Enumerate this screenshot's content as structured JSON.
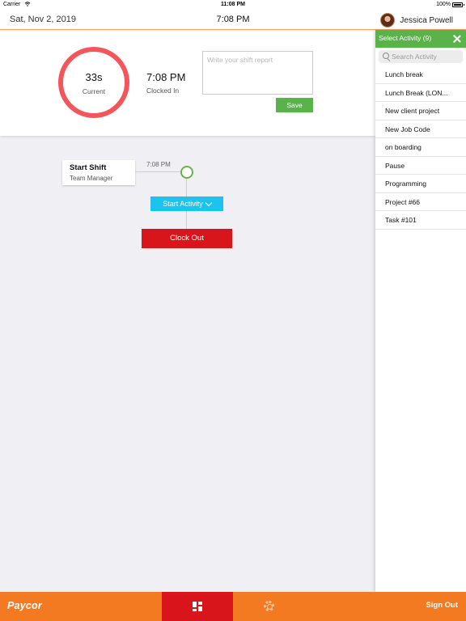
{
  "status_bar": {
    "carrier": "Carrier",
    "clock": "11:08 PM",
    "battery_percent": "100%",
    "icons": [
      "wifi-icon",
      "battery-icon"
    ]
  },
  "top_nav": {
    "date": "Sat, Nov 2, 2019",
    "time": "7:08 PM",
    "user_name": "Jessica Powell"
  },
  "header": {
    "elapsed_value": "33s",
    "elapsed_label": "Current",
    "clocked_time": "7:08 PM",
    "clocked_label": "Clocked In",
    "report_placeholder": "Write your shift report",
    "report_value": "",
    "save_label": "Save"
  },
  "timeline": {
    "shift_title": "Start Shift",
    "shift_role": "Team Manager",
    "shift_time": "7:08 PM",
    "start_activity_label": "Start Activity",
    "clock_out_label": "Clock Out"
  },
  "activity_panel": {
    "title": "Select Activity (9)",
    "search_placeholder": "Search Activity",
    "items": [
      "Lunch break",
      "Lunch Break (LON...",
      "New client project",
      "New Job Code",
      "on boarding",
      "Pause",
      "Programming",
      "Project #66",
      "Task #101"
    ]
  },
  "bottom_bar": {
    "logo": "Paycor",
    "sign_out_label": "Sign Out",
    "tabs": [
      "dashboard-icon",
      "gear-icon"
    ]
  },
  "colors": {
    "accent_orange": "#f47a22",
    "active_tab_red": "#d8151b",
    "timer_ring": "#f4555b",
    "save_green": "#5bb24a",
    "activity_blue": "#1cc3ee"
  }
}
